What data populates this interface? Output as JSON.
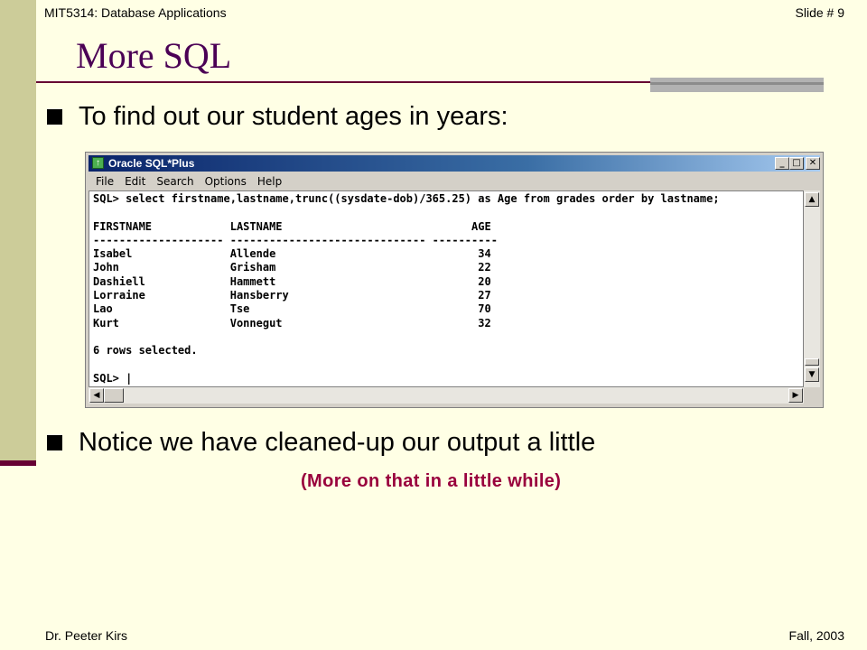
{
  "header": {
    "course": "MIT5314: Database Applications",
    "slide": "Slide # 9"
  },
  "title": "More SQL",
  "bullets": [
    "To find out our student ages in years:",
    "Notice we have cleaned-up our output a little"
  ],
  "note": "(More on that in a little while)",
  "window": {
    "title": "Oracle SQL*Plus",
    "menu": [
      "File",
      "Edit",
      "Search",
      "Options",
      "Help"
    ],
    "console": [
      "SQL> select firstname,lastname,trunc((sysdate-dob)/365.25) as Age from grades order by lastname;",
      "",
      "FIRSTNAME            LASTNAME                             AGE",
      "-------------------- ------------------------------ ----------",
      "Isabel               Allende                               34",
      "John                 Grisham                               22",
      "Dashiell             Hammett                               20",
      "Lorraine             Hansberry                             27",
      "Lao                  Tse                                   70",
      "Kurt                 Vonnegut                              32",
      "",
      "6 rows selected.",
      "",
      "SQL> |"
    ]
  },
  "footer": {
    "author": "Dr. Peeter Kirs",
    "term": "Fall, 2003"
  }
}
